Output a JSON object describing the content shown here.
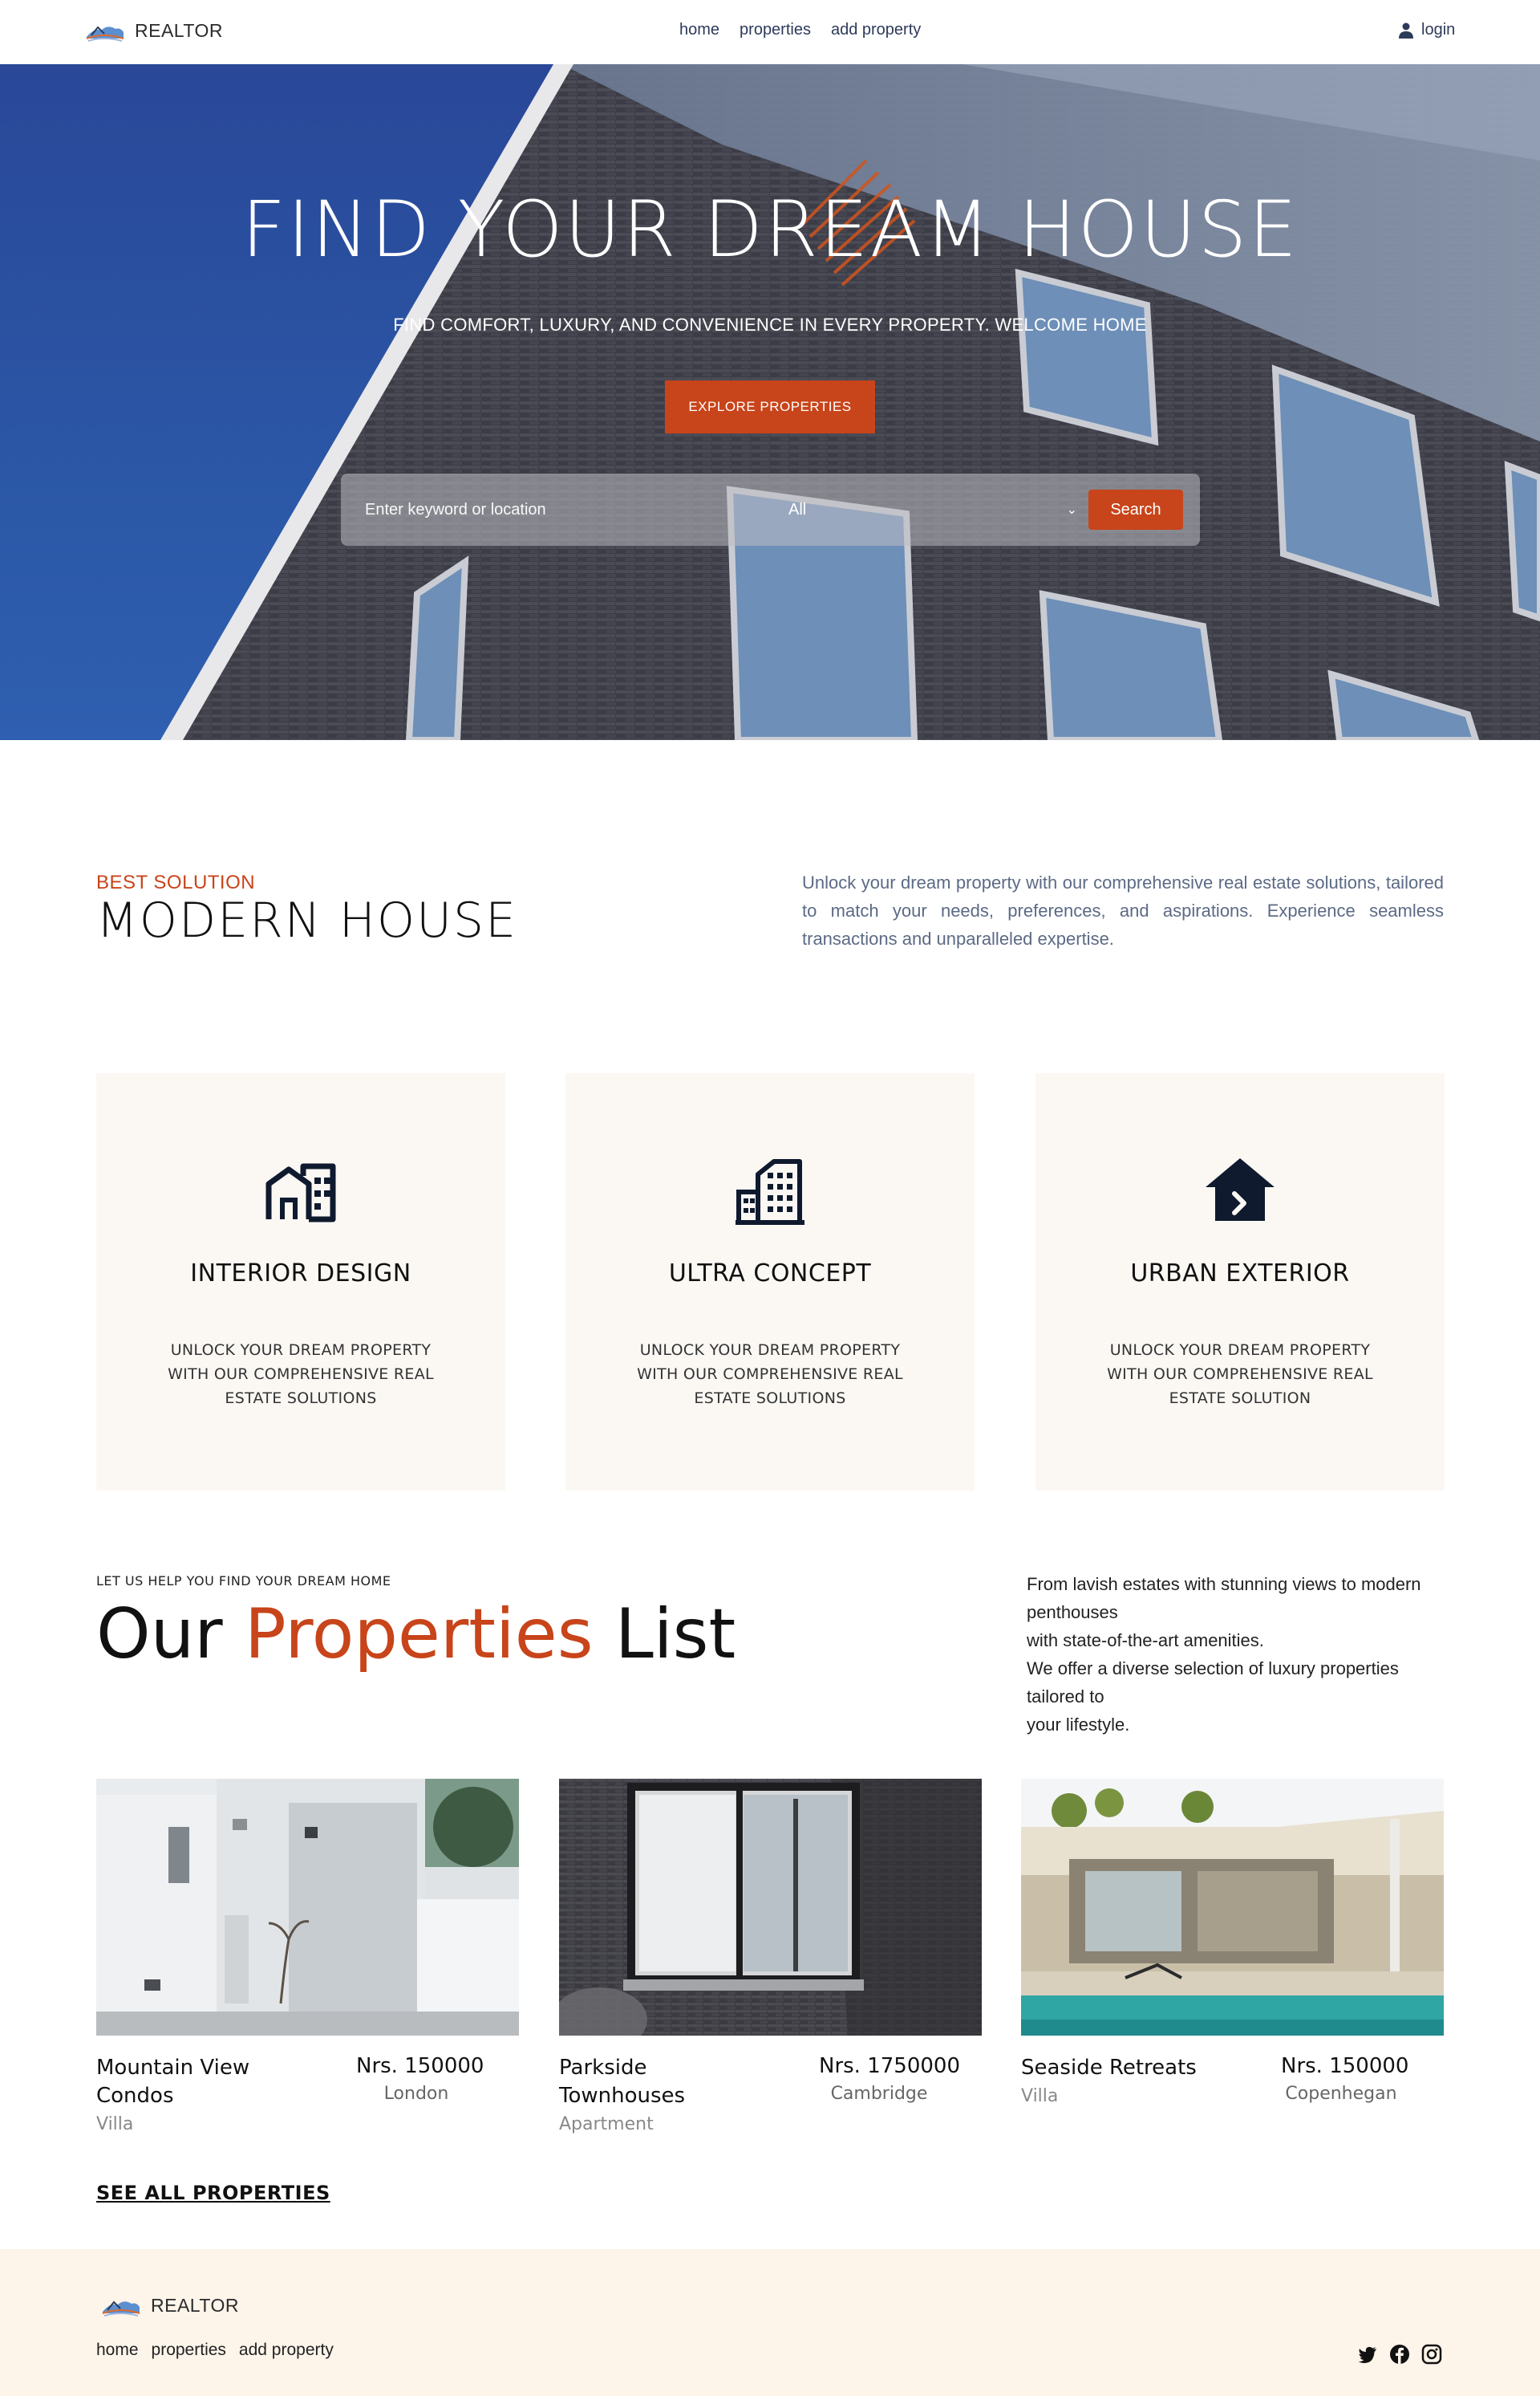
{
  "nav": {
    "brand": "REALTOR",
    "links": [
      "home",
      "properties",
      "add property"
    ],
    "login": "login"
  },
  "hero": {
    "title": "FIND YOUR DREAM HOUSE",
    "subtitle": "FIND COMFORT, LUXURY, AND CONVENIENCE IN EVERY PROPERTY. WELCOME HOME",
    "cta": "EXPLORE PROPERTIES",
    "search": {
      "placeholder": "Enter keyword or location",
      "select_value": "All",
      "button": "Search"
    }
  },
  "solution": {
    "eyebrow": "BEST SOLUTION",
    "title": "MODERN HOUSE",
    "paragraph": "Unlock your dream property with our comprehensive real estate solutions, tailored to match your needs, preferences, and aspirations. Experience seamless transactions and unparalleled expertise."
  },
  "features": [
    {
      "icon": "building-grid-icon",
      "title": "INTERIOR DESIGN",
      "text": "UNLOCK YOUR DREAM PROPERTY WITH OUR COMPREHENSIVE REAL ESTATE SOLUTIONS"
    },
    {
      "icon": "city-building-icon",
      "title": "ULTRA CONCEPT",
      "text": "UNLOCK YOUR DREAM PROPERTY WITH OUR COMPREHENSIVE REAL ESTATE SOLUTIONS"
    },
    {
      "icon": "house-arrow-icon",
      "title": "URBAN EXTERIOR",
      "text": "UNLOCK YOUR DREAM PROPERTY WITH OUR COMPREHENSIVE REAL ESTATE SOLUTION"
    }
  ],
  "properties": {
    "eyebrow": "LET US HELP YOU FIND YOUR DREAM HOME",
    "title_part1": "Our",
    "title_accent": "Properties",
    "title_part2": "List",
    "paragraph_lines": [
      "From lavish estates with stunning views to modern penthouses",
      "with state-of-the-art amenities.",
      "We offer a diverse selection of luxury properties tailored to",
      "your lifestyle."
    ],
    "items": [
      {
        "name": "Mountain View Condos",
        "price": "Nrs. 150000",
        "city": "London",
        "type": "Villa"
      },
      {
        "name": "Parkside Townhouses",
        "price": "Nrs. 1750000",
        "city": "Cambridge",
        "type": "Apartment"
      },
      {
        "name": "Seaside Retreats",
        "price": "Nrs. 150000",
        "city": "Copenhegan",
        "type": "Villa"
      }
    ],
    "see_all": "SEE ALL PROPERTIES"
  },
  "footer": {
    "brand": "REALTOR",
    "links": [
      "home",
      "properties",
      "add property"
    ],
    "social": [
      "twitter-icon",
      "facebook-icon",
      "instagram-icon"
    ]
  },
  "colors": {
    "accent": "#c8441a",
    "hero_sky": "#2b57a6",
    "card_bg": "#fbf8f4",
    "footer_bg": "#fdf4ea"
  }
}
